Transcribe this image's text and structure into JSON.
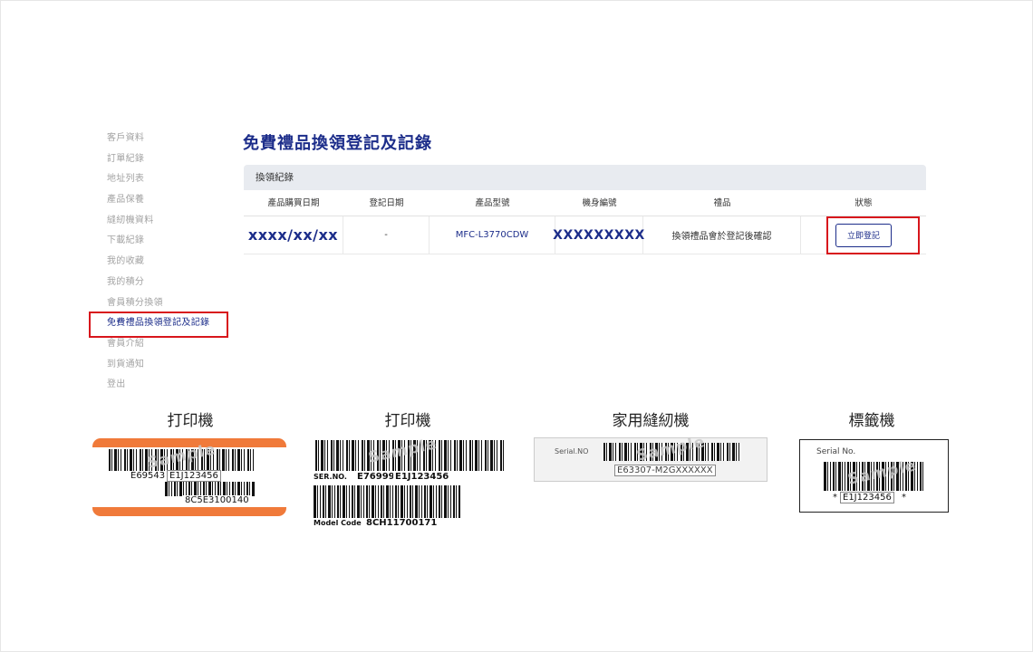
{
  "sidebar": {
    "items": [
      {
        "label": "客戶資料"
      },
      {
        "label": "訂單紀錄"
      },
      {
        "label": "地址列表"
      },
      {
        "label": "產品保養"
      },
      {
        "label": "縫紉機資料"
      },
      {
        "label": "下載紀錄"
      },
      {
        "label": "我的收藏"
      },
      {
        "label": "我的積分"
      },
      {
        "label": "會員積分換領"
      },
      {
        "label": "免費禮品換領登記及記錄"
      },
      {
        "label": "會員介紹"
      },
      {
        "label": "到貨通知"
      },
      {
        "label": "登出"
      }
    ],
    "active_index": 9
  },
  "main": {
    "title": "免費禮品換領登記及記錄",
    "record": {
      "header": "換領紀錄",
      "columns": [
        "產品購買日期",
        "登記日期",
        "產品型號",
        "機身編號",
        "禮品",
        "狀態"
      ],
      "row": {
        "purchase_date": "xxxx/xx/xx",
        "register_date": "-",
        "model": "MFC-L3770CDW",
        "serial": "XXXXXXXXX",
        "gift": "換領禮品會於登記後確認",
        "status_button": "立即登記"
      }
    }
  },
  "examples": [
    {
      "title": "打印機",
      "texts": [
        "E69543",
        "E1J123456",
        "8C5E3100140"
      ],
      "watermark": "Sample"
    },
    {
      "title": "打印機",
      "texts": [
        "SER.NO.",
        "E76999",
        "E1J123456",
        "Model Code",
        "8CH11700171"
      ],
      "watermark": "Sample"
    },
    {
      "title": "家用縫紉機",
      "texts": [
        "Serial.NO",
        "E63307-M2GXXXXXX"
      ],
      "watermark": "Sample"
    },
    {
      "title": "標籤機",
      "texts": [
        "Serial No.",
        "*",
        "E1J123456",
        "*"
      ],
      "watermark": "Sample"
    }
  ],
  "colors": {
    "brand_blue": "#1c2d8a",
    "highlight_red": "#d8161c",
    "label_orange": "#f07a3a"
  }
}
